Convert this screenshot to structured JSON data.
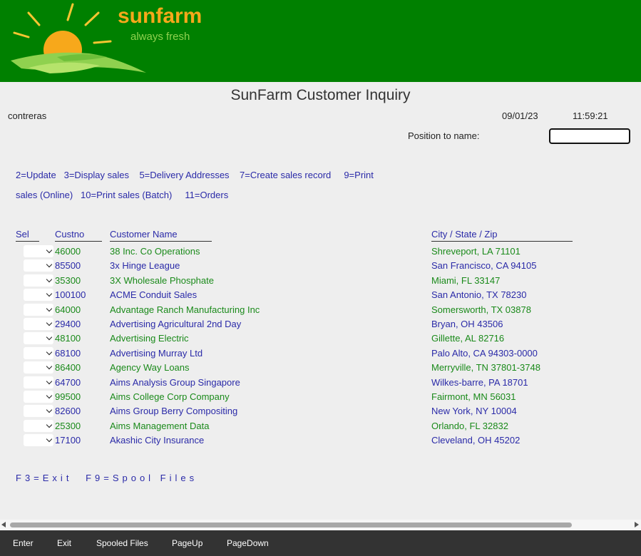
{
  "brand": {
    "name": "sunfarm",
    "tagline": "always fresh"
  },
  "header": {
    "title": "SunFarm Customer Inquiry",
    "user": "contreras",
    "date": "09/01/23",
    "time": "11:59:21",
    "position_label": "Position to name:",
    "position_value": ""
  },
  "options": {
    "line1": [
      "2=Update",
      "3=Display sales",
      "5=Delivery Addresses",
      "7=Create sales record",
      "9=Print"
    ],
    "line2": [
      "sales (Online)",
      "10=Print sales (Batch)",
      "11=Orders"
    ]
  },
  "columns": {
    "sel": "Sel",
    "custno": "Custno",
    "name": "Customer Name",
    "city": "City / State / Zip"
  },
  "rows": [
    {
      "custno": "46000",
      "name": "38 Inc. Co Operations",
      "city": "Shreveport, LA 71101",
      "color": "green"
    },
    {
      "custno": "85500",
      "name": "3x Hinge League",
      "city": "San Francisco, CA 94105",
      "color": "blue"
    },
    {
      "custno": "35300",
      "name": "3X Wholesale Phosphate",
      "city": "Miami, FL 33147",
      "color": "green"
    },
    {
      "custno": "100100",
      "name": "ACME Conduit Sales",
      "city": "San Antonio, TX 78230",
      "color": "blue"
    },
    {
      "custno": "64000",
      "name": "Advantage Ranch Manufacturing Inc",
      "city": "Somersworth, TX 03878",
      "color": "green"
    },
    {
      "custno": "29400",
      "name": "Advertising Agricultural 2nd Day",
      "city": "Bryan, OH 43506",
      "color": "blue"
    },
    {
      "custno": "48100",
      "name": "Advertising Electric",
      "city": "Gillette, AL 82716",
      "color": "green"
    },
    {
      "custno": "68100",
      "name": "Advertising Murray Ltd",
      "city": "Palo Alto, CA 94303-0000",
      "color": "blue"
    },
    {
      "custno": "86400",
      "name": "Agency Way Loans",
      "city": "Merryville, TN 37801-3748",
      "color": "green"
    },
    {
      "custno": "64700",
      "name": "Aims Analysis Group Singapore",
      "city": "Wilkes-barre, PA 18701",
      "color": "blue"
    },
    {
      "custno": "99500",
      "name": "Aims College Corp Company",
      "city": "Fairmont, MN 56031",
      "color": "green"
    },
    {
      "custno": "82600",
      "name": "Aims Group Berry Compositing",
      "city": "New York, NY 10004",
      "color": "blue"
    },
    {
      "custno": "25300",
      "name": "Aims Management Data",
      "city": "Orlando, FL 32832",
      "color": "green"
    },
    {
      "custno": "17100",
      "name": "Akashic City Insurance",
      "city": "Cleveland, OH 45202",
      "color": "blue"
    }
  ],
  "function_keys": [
    "F3=Exit",
    "F9=Spool Files"
  ],
  "footer": {
    "enter": "Enter",
    "exit": "Exit",
    "spooled": "Spooled Files",
    "pageup": "PageUp",
    "pagedown": "PageDown"
  }
}
